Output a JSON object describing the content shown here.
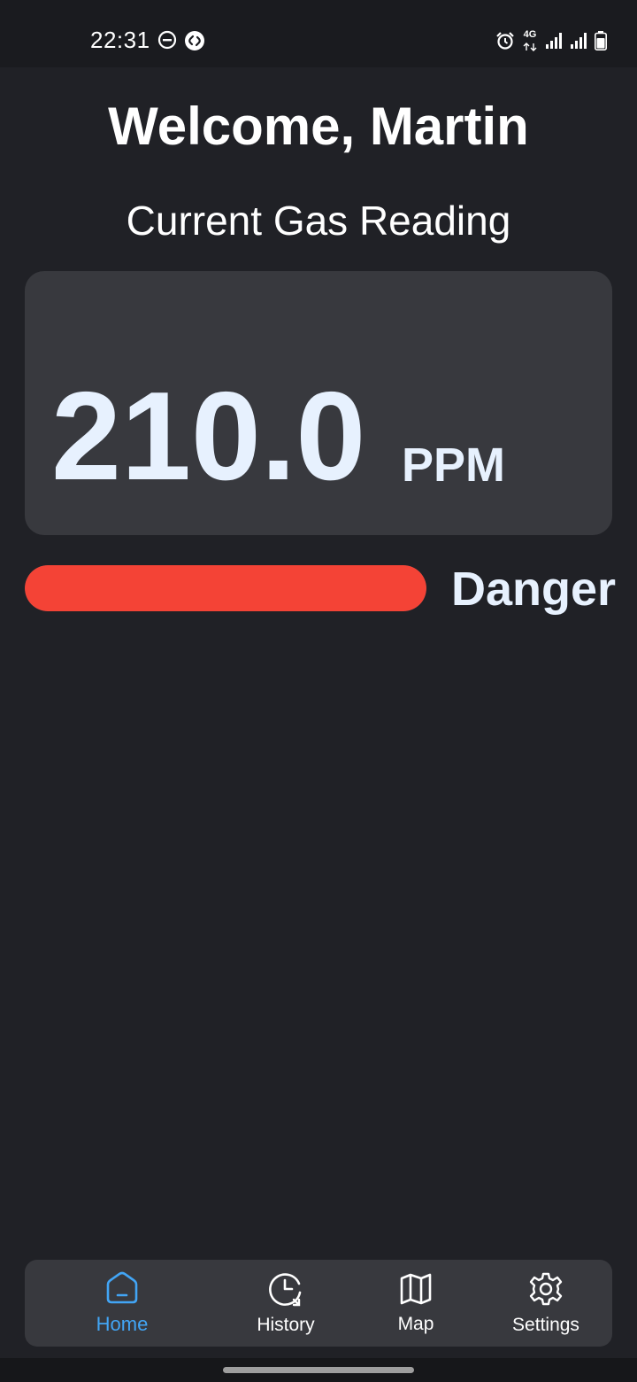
{
  "status_bar": {
    "time": "22:31",
    "network_label": "4G",
    "icons": [
      "do-not-disturb-icon",
      "shazam-icon",
      "alarm-icon",
      "network-4g-icon",
      "signal-icon",
      "signal-icon",
      "battery-icon"
    ]
  },
  "header": {
    "welcome": "Welcome, Martin",
    "subtitle": "Current Gas Reading"
  },
  "reading": {
    "value": "210.0",
    "unit": "PPM"
  },
  "level": {
    "label": "Danger",
    "fill_fraction": 1.0,
    "color": "#f44336"
  },
  "colors": {
    "accent": "#42a5f5",
    "background": "#202126",
    "card": "#38393e",
    "reading_text": "#e7f1fe"
  },
  "bottom_nav": {
    "items": [
      {
        "label": "Home",
        "icon": "home-icon",
        "active": true
      },
      {
        "label": "History",
        "icon": "history-icon",
        "active": false
      },
      {
        "label": "Map",
        "icon": "map-icon",
        "active": false
      },
      {
        "label": "Settings",
        "icon": "gear-icon",
        "active": false
      }
    ]
  }
}
